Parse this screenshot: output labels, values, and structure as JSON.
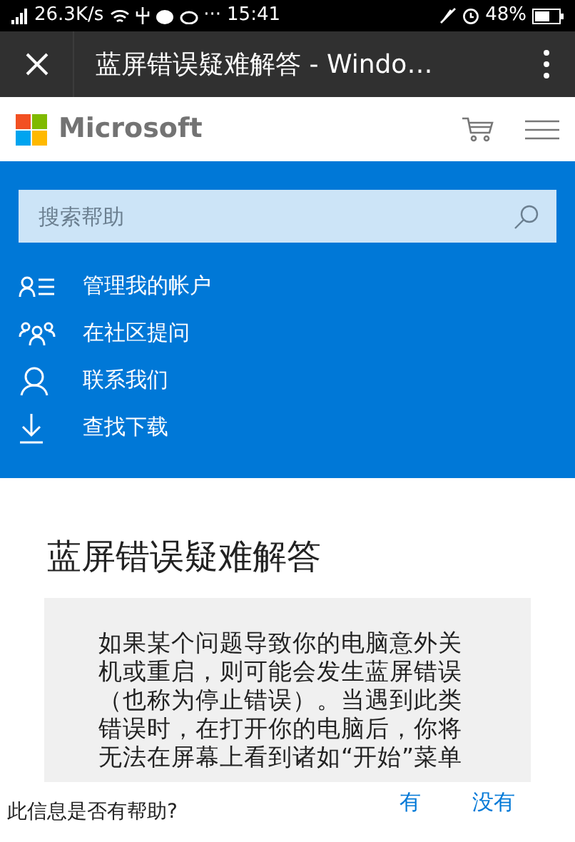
{
  "status_bar": {
    "speed": "26.3K/s",
    "more": "···",
    "time": "15:41",
    "battery": "48%"
  },
  "browser_bar": {
    "title": "蓝屏错误疑难解答 - Windo…"
  },
  "header": {
    "logo_text": "Microsoft"
  },
  "search": {
    "placeholder": "搜索帮助"
  },
  "links": [
    {
      "kind": "account",
      "label": "管理我的帐户"
    },
    {
      "kind": "community",
      "label": "在社区提问"
    },
    {
      "kind": "contact",
      "label": "联系我们"
    },
    {
      "kind": "download",
      "label": "查找下载"
    }
  ],
  "article": {
    "title": "蓝屏错误疑难解答",
    "body": "如果某个问题导致你的电脑意外关机或重启，则可能会发生蓝屏错误（也称为停止错误）。当遇到此类错误时，在打开你的电脑后，你将无法在屏幕上看到诸如“开始”菜单"
  },
  "feedback": {
    "question": "此信息是否有帮助?",
    "yes": "有",
    "no": "没有"
  }
}
